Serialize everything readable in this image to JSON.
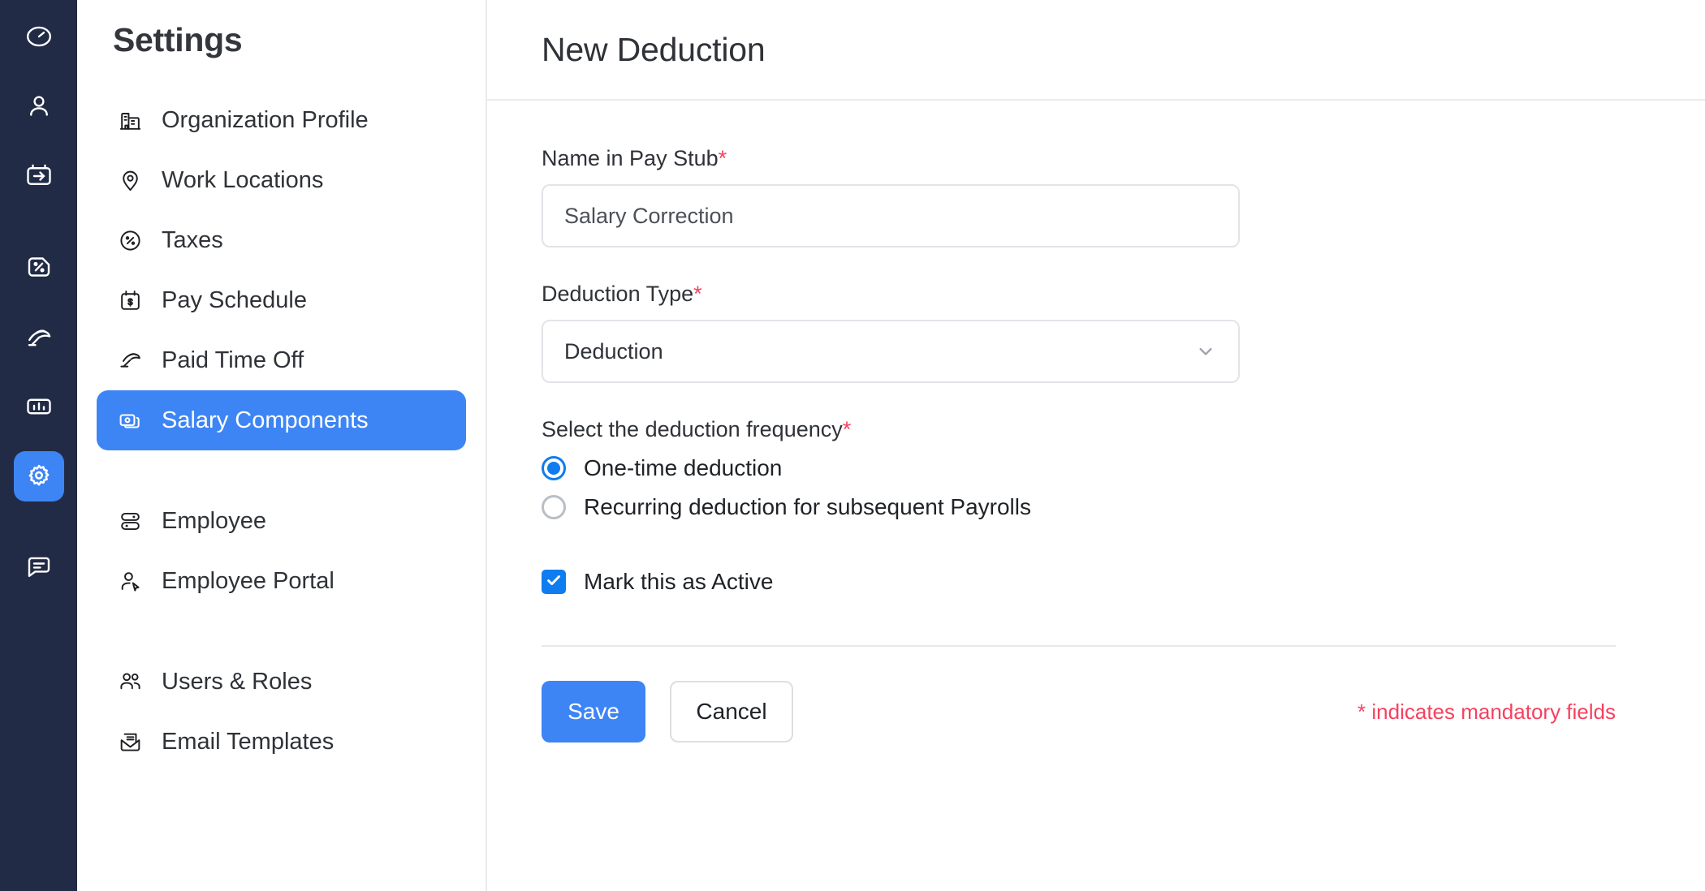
{
  "rail": {
    "items": [
      {
        "icon": "dashboard-gauge-icon",
        "active": false
      },
      {
        "icon": "user-icon",
        "active": false
      },
      {
        "icon": "pay-run-arrow-icon",
        "active": false
      },
      {
        "icon": "tax-percent-icon",
        "active": false
      },
      {
        "icon": "umbrella-leave-icon",
        "active": false
      },
      {
        "icon": "reports-bar-chart-icon",
        "active": false
      },
      {
        "icon": "gear-icon",
        "active": true
      },
      {
        "icon": "chat-message-icon",
        "active": false
      }
    ],
    "accent_color": "#3d85f5",
    "background_color": "#222b45"
  },
  "sidebar": {
    "title": "Settings",
    "items": [
      {
        "label": "Organization Profile",
        "icon": "building-icon",
        "selected": false
      },
      {
        "label": "Work Locations",
        "icon": "map-pin-icon",
        "selected": false
      },
      {
        "label": "Taxes",
        "icon": "percent-circle-icon",
        "selected": false
      },
      {
        "label": "Pay Schedule",
        "icon": "calendar-dollar-icon",
        "selected": false
      },
      {
        "label": "Paid Time Off",
        "icon": "beach-umbrella-icon",
        "selected": false
      },
      {
        "label": "Salary Components",
        "icon": "cards-stack-icon",
        "selected": true
      },
      {
        "label": "Employee",
        "icon": "toggle-sliders-icon",
        "selected": false
      },
      {
        "label": "Employee Portal",
        "icon": "user-cursor-icon",
        "selected": false
      },
      {
        "label": "Users & Roles",
        "icon": "users-group-icon",
        "selected": false
      },
      {
        "label": "Email Templates",
        "icon": "envelope-icon",
        "selected": false
      }
    ]
  },
  "main": {
    "title": "New Deduction",
    "form": {
      "name_field": {
        "label": "Name in Pay Stub",
        "required_marker": "*",
        "value": "Salary Correction"
      },
      "deduction_type": {
        "label": "Deduction Type",
        "required_marker": "*",
        "selected": "Deduction",
        "chevron_icon": "chevron-down-icon"
      },
      "frequency": {
        "label": "Select the deduction frequency",
        "required_marker": "*",
        "options": [
          {
            "label": "One-time deduction",
            "checked": true
          },
          {
            "label": "Recurring deduction for subsequent Payrolls",
            "checked": false
          }
        ]
      },
      "active_checkbox": {
        "label": "Mark this as Active",
        "checked": true,
        "icon": "checkmark-icon"
      }
    },
    "footer": {
      "save_label": "Save",
      "cancel_label": "Cancel",
      "mandatory_note": "* indicates mandatory fields",
      "mandatory_color": "#f6415f"
    }
  }
}
